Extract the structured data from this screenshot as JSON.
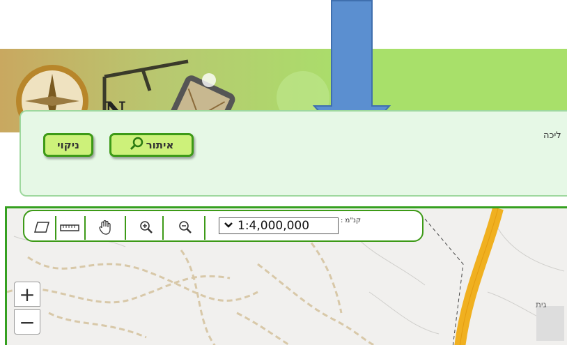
{
  "search_panel": {
    "locate_label": "איתור",
    "clear_label": "ניקוי",
    "partial_text": "ליכה"
  },
  "map_toolbar": {
    "scale_value": "1:4,000,000",
    "scale_unit": "קנ\"מ :",
    "tools": [
      "eraser-icon",
      "ruler-icon",
      "hand-pan-icon",
      "zoom-in-icon",
      "zoom-out-icon"
    ]
  },
  "map": {
    "zoom_in_label": "+",
    "zoom_out_label": "−",
    "place_label": "גית"
  },
  "colors": {
    "brand_green": "#3d9a17",
    "button_fill": "#cdf17a",
    "panel_fill": "#e6f8e6",
    "banner_green": "#a8e06a",
    "arrow_blue": "#5b8fd0",
    "road_orange": "#f0b020"
  }
}
